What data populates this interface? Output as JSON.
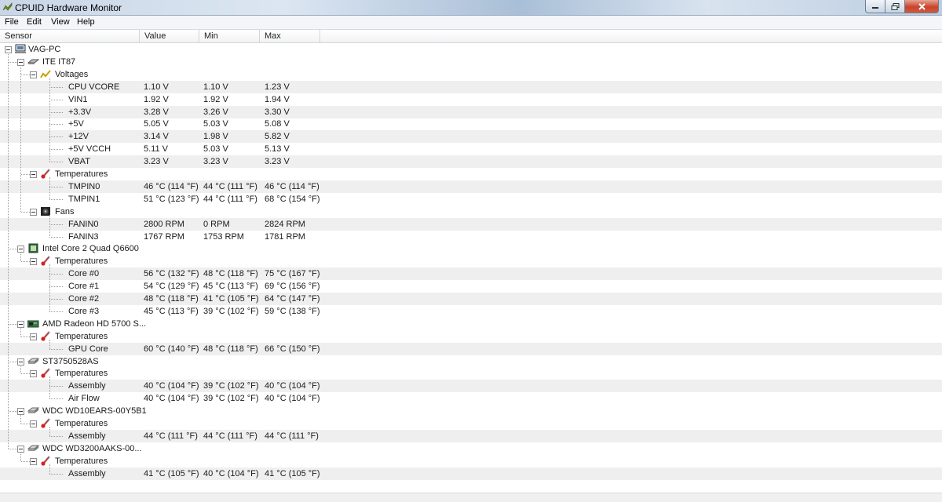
{
  "window": {
    "title": "CPUID Hardware Monitor"
  },
  "menu": [
    "File",
    "Edit",
    "View",
    "Help"
  ],
  "columns": [
    "Sensor",
    "Value",
    "Min",
    "Max"
  ],
  "tree": [
    {
      "level": 0,
      "label": "VAG-PC",
      "icon": "computer-icon"
    },
    {
      "level": 1,
      "label": "ITE IT87",
      "icon": "chip-icon"
    },
    {
      "level": 2,
      "label": "Voltages",
      "icon": "voltage-icon"
    },
    {
      "level": 3,
      "label": "CPU VCORE",
      "value": "1.10 V",
      "min": "1.10 V",
      "max": "1.23 V"
    },
    {
      "level": 3,
      "label": "VIN1",
      "value": "1.92 V",
      "min": "1.92 V",
      "max": "1.94 V"
    },
    {
      "level": 3,
      "label": "+3.3V",
      "value": "3.28 V",
      "min": "3.26 V",
      "max": "3.30 V"
    },
    {
      "level": 3,
      "label": "+5V",
      "value": "5.05 V",
      "min": "5.03 V",
      "max": "5.08 V"
    },
    {
      "level": 3,
      "label": "+12V",
      "value": "3.14 V",
      "min": "1.98 V",
      "max": "5.82 V"
    },
    {
      "level": 3,
      "label": "+5V VCCH",
      "value": "5.11 V",
      "min": "5.03 V",
      "max": "5.13 V"
    },
    {
      "level": 3,
      "label": "VBAT",
      "value": "3.23 V",
      "min": "3.23 V",
      "max": "3.23 V"
    },
    {
      "level": 2,
      "label": "Temperatures",
      "icon": "thermometer-icon"
    },
    {
      "level": 3,
      "label": "TMPIN0",
      "value": "46 °C  (114 °F)",
      "min": "44 °C  (111 °F)",
      "max": "46 °C  (114 °F)"
    },
    {
      "level": 3,
      "label": "TMPIN1",
      "value": "51 °C  (123 °F)",
      "min": "44 °C  (111 °F)",
      "max": "68 °C  (154 °F)"
    },
    {
      "level": 2,
      "label": "Fans",
      "icon": "fan-icon"
    },
    {
      "level": 3,
      "label": "FANIN0",
      "value": "2800 RPM",
      "min": "0 RPM",
      "max": "2824 RPM"
    },
    {
      "level": 3,
      "label": "FANIN3",
      "value": "1767 RPM",
      "min": "1753 RPM",
      "max": "1781 RPM"
    },
    {
      "level": 1,
      "label": "Intel Core 2 Quad Q6600",
      "icon": "cpu-icon"
    },
    {
      "level": 2,
      "label": "Temperatures",
      "icon": "thermometer-icon"
    },
    {
      "level": 3,
      "label": "Core #0",
      "value": "56 °C  (132 °F)",
      "min": "48 °C  (118 °F)",
      "max": "75 °C  (167 °F)"
    },
    {
      "level": 3,
      "label": "Core #1",
      "value": "54 °C  (129 °F)",
      "min": "45 °C  (113 °F)",
      "max": "69 °C  (156 °F)"
    },
    {
      "level": 3,
      "label": "Core #2",
      "value": "48 °C  (118 °F)",
      "min": "41 °C  (105 °F)",
      "max": "64 °C  (147 °F)"
    },
    {
      "level": 3,
      "label": "Core #3",
      "value": "45 °C  (113 °F)",
      "min": "39 °C  (102 °F)",
      "max": "59 °C  (138 °F)"
    },
    {
      "level": 1,
      "label": "AMD Radeon HD 5700 S...",
      "icon": "gpu-icon"
    },
    {
      "level": 2,
      "label": "Temperatures",
      "icon": "thermometer-icon"
    },
    {
      "level": 3,
      "label": "GPU Core",
      "value": "60 °C  (140 °F)",
      "min": "48 °C  (118 °F)",
      "max": "66 °C  (150 °F)"
    },
    {
      "level": 1,
      "label": "ST3750528AS",
      "icon": "disk-icon"
    },
    {
      "level": 2,
      "label": "Temperatures",
      "icon": "thermometer-icon"
    },
    {
      "level": 3,
      "label": "Assembly",
      "value": "40 °C  (104 °F)",
      "min": "39 °C  (102 °F)",
      "max": "40 °C  (104 °F)"
    },
    {
      "level": 3,
      "label": "Air Flow",
      "value": "40 °C  (104 °F)",
      "min": "39 °C  (102 °F)",
      "max": "40 °C  (104 °F)"
    },
    {
      "level": 1,
      "label": "WDC WD10EARS-00Y5B1",
      "icon": "disk-icon"
    },
    {
      "level": 2,
      "label": "Temperatures",
      "icon": "thermometer-icon"
    },
    {
      "level": 3,
      "label": "Assembly",
      "value": "44 °C  (111 °F)",
      "min": "44 °C  (111 °F)",
      "max": "44 °C  (111 °F)"
    },
    {
      "level": 1,
      "label": "WDC WD3200AAKS-00...",
      "icon": "disk-icon"
    },
    {
      "level": 2,
      "label": "Temperatures",
      "icon": "thermometer-icon"
    },
    {
      "level": 3,
      "label": "Assembly",
      "value": "41 °C  (105 °F)",
      "min": "40 °C  (104 °F)",
      "max": "41 °C  (105 °F)"
    }
  ],
  "colors": {
    "row_shade": "#efefef",
    "header_border": "#d5d5d5",
    "close_button": "#c7452c"
  }
}
